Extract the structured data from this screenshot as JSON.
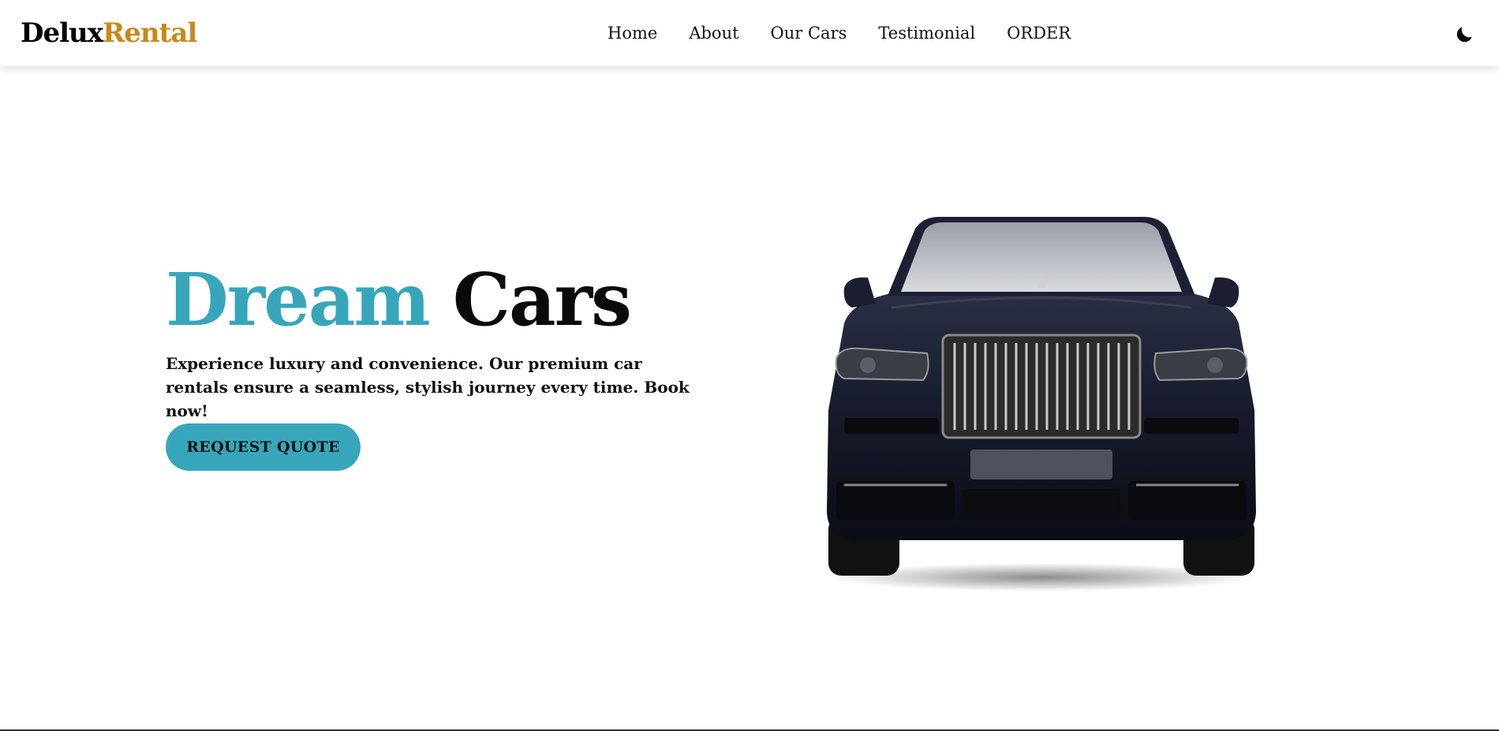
{
  "brand": {
    "part1": "Delux",
    "part2": "Rental",
    "accent_color": "#c8891a"
  },
  "nav": {
    "items": [
      {
        "label": "Home"
      },
      {
        "label": "About"
      },
      {
        "label": "Our Cars"
      },
      {
        "label": "Testimonial"
      },
      {
        "label": "ORDER"
      }
    ],
    "theme_toggle_icon": "moon-icon"
  },
  "hero": {
    "title_part1": "Dream",
    "title_part2": "Cars",
    "title_accent_color": "#37a6bb",
    "description": "Experience luxury and convenience. Our premium car rentals ensure a seamless, stylish journey every time. Book now!",
    "cta_label": "REQUEST QUOTE",
    "image_icon": "luxury-suv-image"
  }
}
